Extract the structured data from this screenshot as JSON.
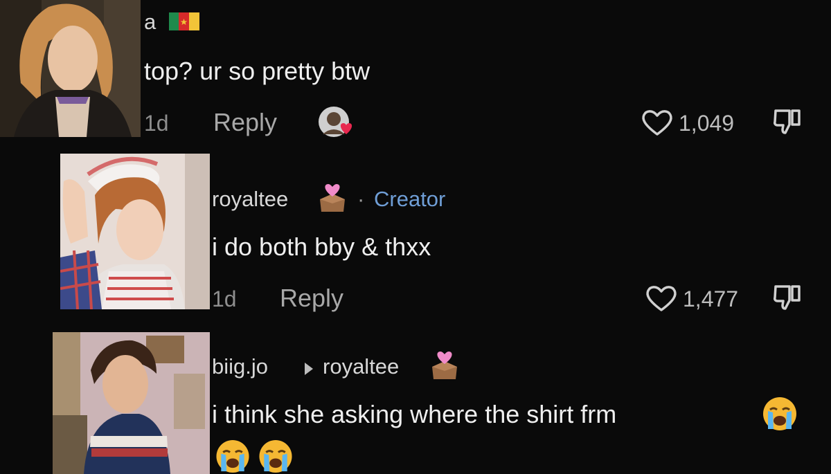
{
  "comments": [
    {
      "username": "a",
      "text": "top? ur so pretty btw",
      "age": "1d",
      "reply_label": "Reply",
      "likes": "1,049"
    },
    {
      "username": "royaltee",
      "badge": "Creator",
      "separator": "·",
      "text": "i do both bby & thxx",
      "age": "1d",
      "reply_label": "Reply",
      "likes": "1,477"
    },
    {
      "username": "biig.jo",
      "reply_to": "royaltee",
      "text": "i think she asking where the shirt frm"
    }
  ],
  "icons": {
    "flag": "cameroon-flag-icon",
    "heart": "heart-outline-icon",
    "dislike": "thumbs-down-icon",
    "reply_arrow": "reply-arrow-icon",
    "emoji": "crying-face-emoji-icon",
    "creator_liked": "creator-liked-avatar-icon",
    "user_emoji": "heart-box-emoji-icon"
  },
  "colors": {
    "background": "#0a0a0a",
    "creator_accent": "#6f9ed6",
    "liked_heart": "#e8284f"
  }
}
